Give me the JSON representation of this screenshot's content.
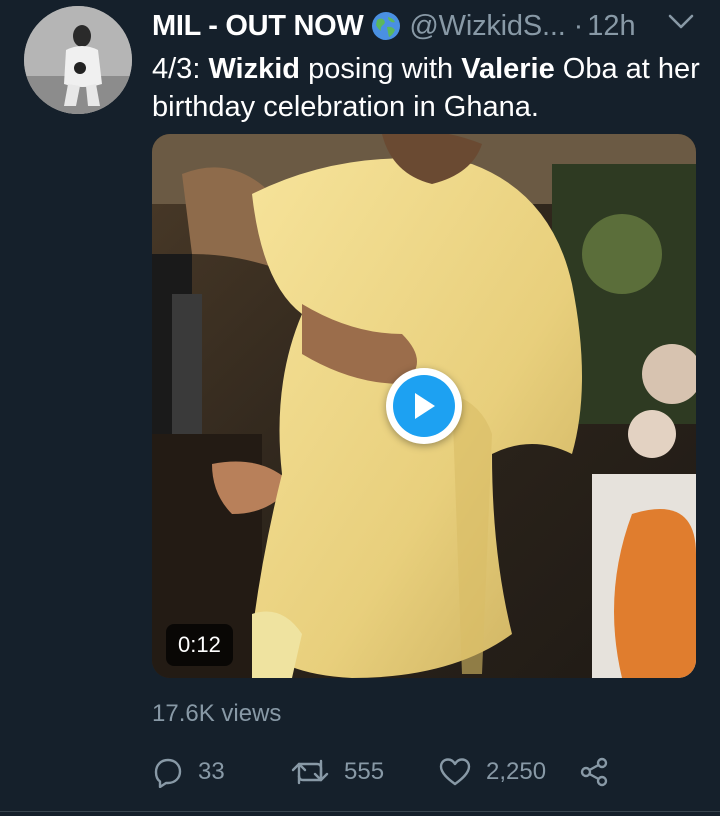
{
  "tweet": {
    "author": {
      "display_name": "MIL - OUT NOW",
      "handle": "@WizkidS...",
      "badge": "globe-icon"
    },
    "separator": "·",
    "timestamp": "12h",
    "text": {
      "prefix": "4/3: ",
      "bold_1": "Wizkid",
      "mid_1": " posing with ",
      "bold_2": "Valerie",
      "rest": " Oba at her birthday celebration in Ghana."
    },
    "media": {
      "type": "video",
      "duration": "0:12"
    },
    "views": "17.6K views",
    "actions": {
      "replies": "33",
      "retweets": "555",
      "likes": "2,250"
    }
  },
  "colors": {
    "background": "#15202b",
    "text_primary": "#ffffff",
    "text_secondary": "#8899a6",
    "accent": "#1da1f2"
  }
}
